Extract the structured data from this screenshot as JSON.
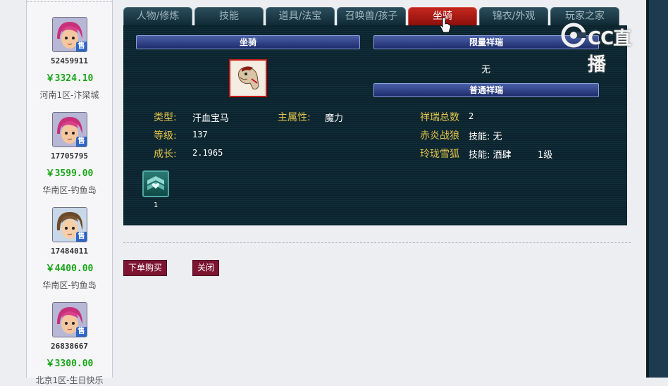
{
  "listings": [
    {
      "seller_id": "52459911",
      "price": "￥3324.10",
      "server": "河南1区-汴梁城",
      "badge": "售",
      "avatar": "pink-hair-avatar"
    },
    {
      "seller_id": "17705795",
      "price": "￥3599.00",
      "server": "华南区-钓鱼岛",
      "badge": "售",
      "avatar": "pink-hair-avatar"
    },
    {
      "seller_id": "17484011",
      "price": "￥4400.00",
      "server": "华南区-钓鱼岛",
      "badge": "售",
      "avatar": "brown-hair-avatar"
    },
    {
      "seller_id": "26838667",
      "price": "￥3300.00",
      "server": "北京1区-生日快乐",
      "badge": "售",
      "avatar": "pink-hair-avatar"
    }
  ],
  "tabs": [
    {
      "label": "人物/修炼",
      "active": false
    },
    {
      "label": "技能",
      "active": false
    },
    {
      "label": "道具/法宝",
      "active": false
    },
    {
      "label": "召唤兽/孩子",
      "active": false
    },
    {
      "label": "坐骑",
      "active": true
    },
    {
      "label": "锦衣/外观",
      "active": false
    },
    {
      "label": "玩家之家",
      "active": false
    }
  ],
  "panel": {
    "mount_header": "坐骑",
    "limited_header": "限量祥瑞",
    "limited_value": "无",
    "normal_header": "普通祥瑞",
    "mount_icon": "horse-mount-icon",
    "type_label": "类型:",
    "type_value": "汗血宝马",
    "attr_label": "主属性:",
    "attr_value": "魔力",
    "level_label": "等级:",
    "level_value": "137",
    "growth_label": "成长:",
    "growth_value": "2.1965",
    "total_label": "祥瑞总数",
    "total_value": "2",
    "rui1_name": "赤炎战狼",
    "rui1_skill": "技能: 无",
    "rui2_name": "玲珑雪狐",
    "rui2_skill": "技能: 酒肆",
    "rui2_level": "1级",
    "skill_count": "1"
  },
  "buttons": {
    "order": "下单购买",
    "close": "关闭"
  },
  "watermark": {
    "text": "CC直播"
  },
  "colors": {
    "active_tab": "#c2281f",
    "price": "#1aa61a",
    "label": "#e1c24a",
    "button": "#7c1432"
  }
}
